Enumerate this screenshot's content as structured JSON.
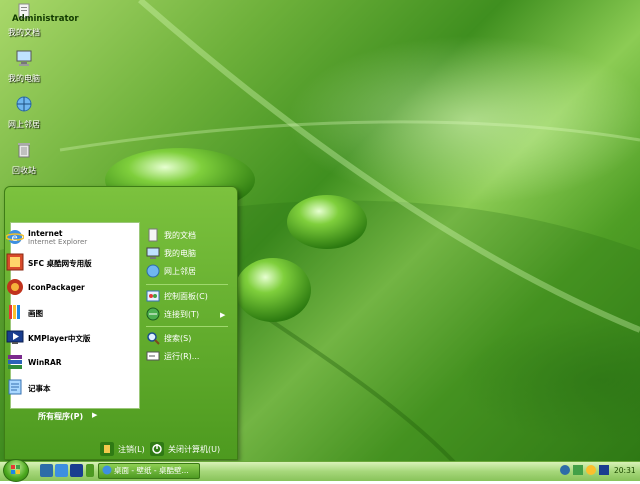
{
  "desktop": {
    "icons": [
      {
        "label": "我的文档",
        "icon": "folder-documents-icon"
      },
      {
        "label": "我的电脑",
        "icon": "computer-icon"
      },
      {
        "label": "网上邻居",
        "icon": "network-icon"
      },
      {
        "label": "回收站",
        "icon": "recycle-bin-icon"
      }
    ]
  },
  "start_menu": {
    "user_name": "Administrator",
    "pinned": [
      {
        "name": "Internet",
        "sub": "Internet Explorer",
        "icon": "internet-explorer-icon"
      },
      {
        "name": "SFC 桌酷网专用版",
        "icon": "sfc-icon"
      },
      {
        "name": "IconPackager",
        "icon": "iconpackager-icon"
      },
      {
        "name": "画图",
        "icon": "paint-icon"
      },
      {
        "name": "KMPlayer中文版",
        "icon": "kmplayer-icon"
      },
      {
        "name": "WinRAR",
        "icon": "winrar-icon"
      },
      {
        "name": "记事本",
        "icon": "notepad-icon"
      }
    ],
    "all_programs": "所有程序(P)",
    "places": [
      {
        "name": "我的文档",
        "icon": "documents-icon"
      },
      {
        "name": "我的电脑",
        "icon": "computer-icon"
      },
      {
        "name": "网上邻居",
        "icon": "network-icon"
      },
      {
        "name": "控制面板(C)",
        "icon": "control-panel-icon"
      },
      {
        "name": "连接到(T)",
        "icon": "connect-icon"
      },
      {
        "name": "搜索(S)",
        "icon": "search-icon"
      },
      {
        "name": "运行(R)...",
        "icon": "run-icon"
      }
    ],
    "logoff": "注销(L)",
    "shutdown": "关闭计算机(U)"
  },
  "taskbar": {
    "task_label": "桌面 - 壁纸 - 桌酷壁...",
    "clock": "20:31"
  },
  "colors": {
    "accent": "#4d9a1f",
    "taskbar": "#a6d77a"
  }
}
